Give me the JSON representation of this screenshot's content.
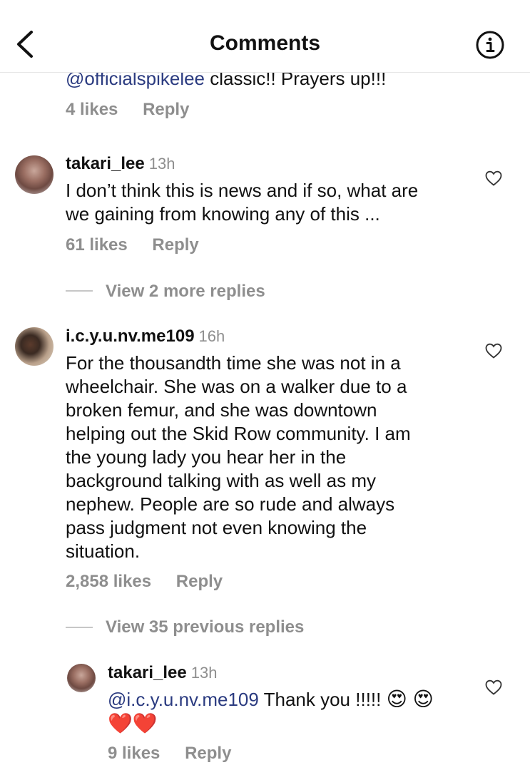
{
  "header": {
    "title": "Comments"
  },
  "comments": [
    {
      "mention": "@officialspikelee",
      "text": " classic!! Prayers up!!!",
      "likes": "4 likes",
      "reply": "Reply"
    },
    {
      "username": "takari_lee",
      "time": "13h",
      "text_lines": [
        "I don’t think this is news and if so, what are",
        "we gaining from knowing any of this ..."
      ],
      "likes": "61 likes",
      "reply": "Reply",
      "view_replies": "View 2 more replies"
    },
    {
      "username": "i.c.y.u.nv.me109",
      "time": "16h",
      "text_lines": [
        "For the thousandth time she was not in a",
        "wheelchair. She was on a walker due to a",
        "broken femur, and she was downtown",
        "helping out the Skid Row community. I am",
        "the young lady you hear her in the",
        "background talking with as well as my",
        "nephew. People are so rude and always",
        "pass judgment not even knowing the",
        "situation."
      ],
      "likes": "2,858 likes",
      "reply": "Reply",
      "view_replies": "View 35 previous replies"
    },
    {
      "username": "takari_lee",
      "time": "13h",
      "mention": "@i.c.y.u.nv.me109",
      "text": " Thank you !!!!! ",
      "emojis_line1": "😍 😍",
      "emojis_line2": "❤️❤️",
      "likes": "9 likes",
      "reply": "Reply"
    }
  ],
  "icons": {
    "back": "chevron-left-icon",
    "info": "info-circle-icon",
    "like": "heart-outline-icon"
  }
}
